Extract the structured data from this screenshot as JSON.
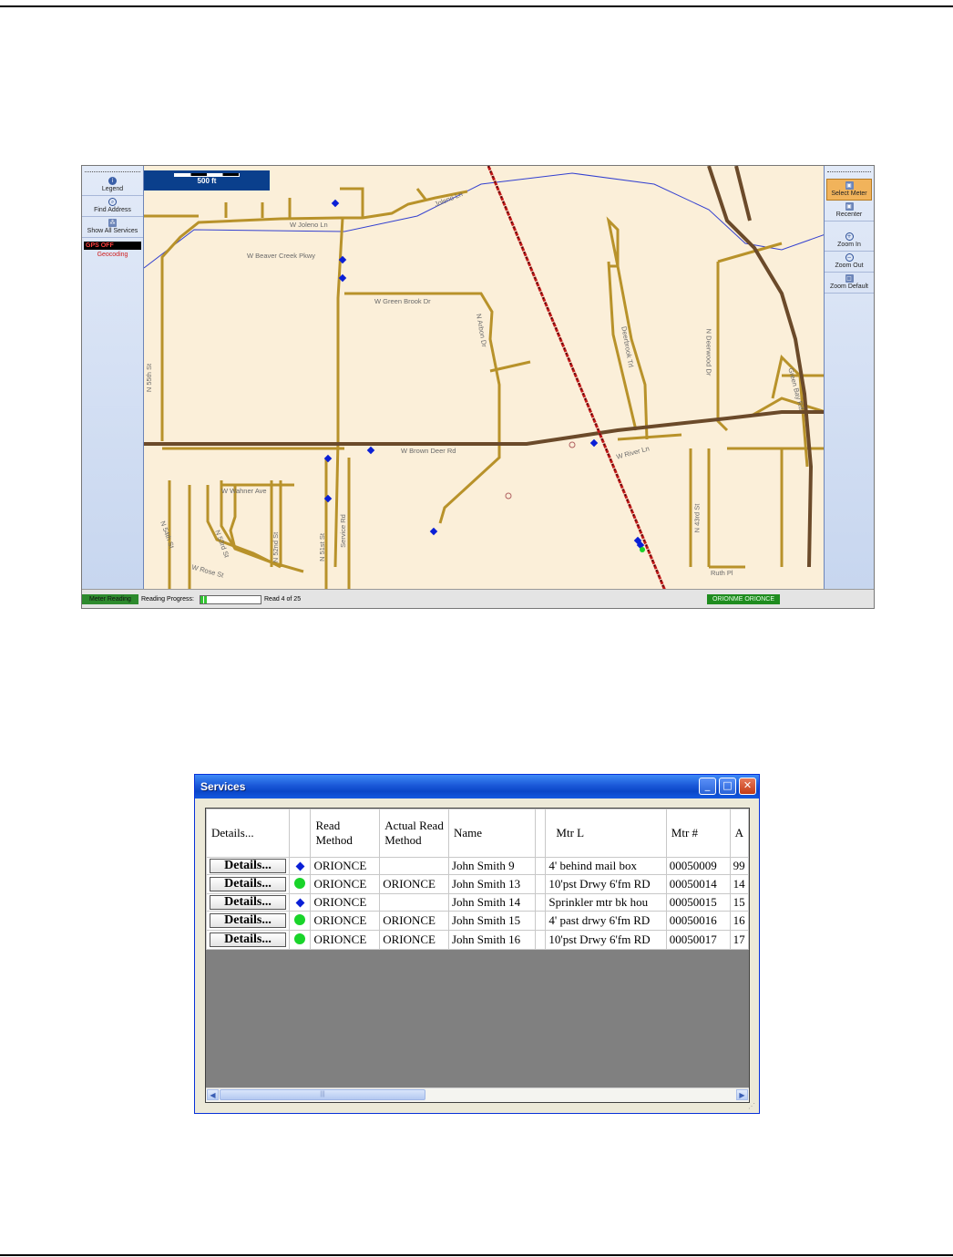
{
  "map_window": {
    "left_panel": {
      "items": [
        {
          "label": "Legend",
          "icon": "info-icon"
        },
        {
          "label": "Find Address",
          "icon": "magnifier-icon"
        },
        {
          "label": "Show All Services",
          "icon": "services-icon"
        }
      ],
      "gps_status": "GPS OFF",
      "geocoding": "Geocoding"
    },
    "right_panel": {
      "items": [
        {
          "label": "Select Meter",
          "icon": "select-meter-icon"
        },
        {
          "label": "Recenter",
          "icon": "recenter-icon"
        },
        {
          "label": "Zoom In",
          "icon": "zoom-in-icon"
        },
        {
          "label": "Zoom Out",
          "icon": "zoom-out-icon"
        },
        {
          "label": "Zoom Default",
          "icon": "zoom-default-icon"
        }
      ]
    },
    "scale_label": "500 ft",
    "streets": [
      {
        "label": "W Joleno Ln"
      },
      {
        "label": "Joleno Ln"
      },
      {
        "label": "W Beaver Creek Pkwy"
      },
      {
        "label": "W Green Brook Dr"
      },
      {
        "label": "N Arbon Dr"
      },
      {
        "label": "N 55th St"
      },
      {
        "label": "W Brown Deer Rd"
      },
      {
        "label": "W Wahner Ave"
      },
      {
        "label": "N 54th St"
      },
      {
        "label": "N 53rd St"
      },
      {
        "label": "W Rose St"
      },
      {
        "label": "N 52nd St"
      },
      {
        "label": "N 51st St"
      },
      {
        "label": "Service Rd"
      },
      {
        "label": "Deerbrook Trl"
      },
      {
        "label": "N Deerwood Dr"
      },
      {
        "label": "W River Ln"
      },
      {
        "label": "N 43rd St"
      },
      {
        "label": "Ruth Pl"
      },
      {
        "label": "Green Bay Rd"
      }
    ],
    "status_bar": {
      "mode": "Meter Reading",
      "progress_label": "Reading Progress:",
      "progress_fraction": 0.16,
      "read_count": "Read 4 of 25",
      "route": "ORIONME ORIONCE"
    }
  },
  "services_window": {
    "title": "Services",
    "columns": [
      "Details...",
      "",
      "Read Method",
      "Actual Read Method",
      "Name",
      "",
      "Mtr L",
      "Mtr #",
      "A"
    ],
    "rows": [
      {
        "details": "Details...",
        "indicator": "diamond",
        "read_method": "ORIONCE",
        "actual_read_method": "",
        "name": "John Smith 9",
        "mtr_l": "4' behind mail box",
        "mtr_no": "00050009",
        "a": "99"
      },
      {
        "details": "Details...",
        "indicator": "circle",
        "read_method": "ORIONCE",
        "actual_read_method": "ORIONCE",
        "name": "John Smith 13",
        "mtr_l": "10'pst Drwy 6'fm RD",
        "mtr_no": "00050014",
        "a": "14"
      },
      {
        "details": "Details...",
        "indicator": "diamond",
        "read_method": "ORIONCE",
        "actual_read_method": "",
        "name": "John Smith 14",
        "mtr_l": "Sprinkler mtr bk hou",
        "mtr_no": "00050015",
        "a": "15"
      },
      {
        "details": "Details...",
        "indicator": "circle",
        "read_method": "ORIONCE",
        "actual_read_method": "ORIONCE",
        "name": "John Smith 15",
        "mtr_l": "4' past drwy 6'fm RD",
        "mtr_no": "00050016",
        "a": "16"
      },
      {
        "details": "Details...",
        "indicator": "circle",
        "read_method": "ORIONCE",
        "actual_read_method": "ORIONCE",
        "name": "John Smith 16",
        "mtr_l": "10'pst Drwy 6'fm RD",
        "mtr_no": "00050017",
        "a": "17"
      }
    ]
  },
  "colors": {
    "diamond_indicator": "#0a1fd6",
    "circle_indicator": "#19d42a",
    "railroad": "#c01818",
    "roads": "#b8922a",
    "major_road": "#6b4a2a",
    "creek": "#3340d0",
    "map_background": "#fbefd9"
  }
}
